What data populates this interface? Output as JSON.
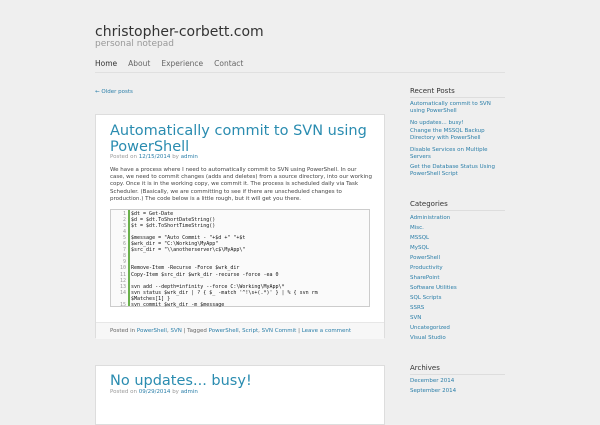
{
  "site": {
    "title": "christopher-corbett.com",
    "description": "personal notepad"
  },
  "nav": [
    "Home",
    "About",
    "Experience",
    "Contact"
  ],
  "older_posts": "← Older posts",
  "post1": {
    "title": "Automatically commit to SVN using PowerShell",
    "meta_prefix": "Posted on",
    "date": "12/15/2014",
    "by": "by",
    "author": "admin",
    "body": "We have a process where I need to automatically commit to SVN using PowerShell.  In our case, we need to commit changes (adds and deletes) from a source directory, into our working copy.  Once it is in the working copy, we commit it.  The process is scheduled daily via Task Scheduler. (Basically, we are committing to see if there are unscheduled changes to production.) The code below is a little rough, but it will get you there.",
    "code": [
      {
        "n": "1",
        "t": "$dt = Get-Date"
      },
      {
        "n": "2",
        "t": "$d  = $dt.ToShortDateString()"
      },
      {
        "n": "3",
        "t": "$t  = $dt.ToShortTimeString()"
      },
      {
        "n": "4",
        "t": ""
      },
      {
        "n": "5",
        "t": "$message = \"Auto Commit - \"+$d +\" \"+$t"
      },
      {
        "n": "6",
        "t": "$wrk_dir = \"C:\\Working\\MyApp\""
      },
      {
        "n": "7",
        "t": "$src_dir = \"\\\\anotherserver\\c$\\MyApp\\\""
      },
      {
        "n": "8",
        "t": ""
      },
      {
        "n": "9",
        "t": ""
      },
      {
        "n": "10",
        "t": "Remove-Item -Recurse -Force $wrk_dir"
      },
      {
        "n": "11",
        "t": "Copy-Item $src_dir $wrk_dir -recurse -force -ea 0"
      },
      {
        "n": "12",
        "t": ""
      },
      {
        "n": "13",
        "t": "svn add --depth=infinity --force C:\\Working\\MyApp\\*"
      },
      {
        "n": "14",
        "t": "svn status $wrk_dir | ? { $_ -match '^!\\s+(.*)' } | % { svn rm"
      },
      {
        "n": "",
        "t": "$Matches[1] }"
      },
      {
        "n": "15",
        "t": "svn commit $wrk_dir -m $message"
      }
    ],
    "footer": {
      "posted_in": "Posted in",
      "cat1": "PowerShell",
      "sep1": ",",
      "cat2": "SVN",
      "tagged": "| Tagged",
      "tag1": "PowerShell",
      "tag2": "Script",
      "tag3": "SVN Commit",
      "leave": "Leave a comment"
    }
  },
  "post2": {
    "title": "No updates... busy!",
    "meta_prefix": "Posted on",
    "date": "09/29/2014",
    "by": "by",
    "author": "admin"
  },
  "sidebar": {
    "recent_title": "Recent Posts",
    "recent": [
      "Automatically commit to SVN using PowerShell",
      "No updates... busy!",
      "Change the MSSQL Backup Directory with PowerShell",
      "Disable Services on Multiple Servers",
      "Get the Database Status Using PowerShell Script"
    ],
    "categories_title": "Categories",
    "categories": [
      "Administration",
      "Misc.",
      "MSSQL",
      "MySQL",
      "PowerShell",
      "Productivity",
      "SharePoint",
      "Software Utilities",
      "SQL Scripts",
      "SSRS",
      "SVN",
      "Uncategorized",
      "Visual Studio"
    ],
    "archives_title": "Archives",
    "archives": [
      "December 2014",
      "September 2014"
    ]
  },
  "colors": {
    "link": "#2a7ea8",
    "title": "#2a8cb0"
  }
}
